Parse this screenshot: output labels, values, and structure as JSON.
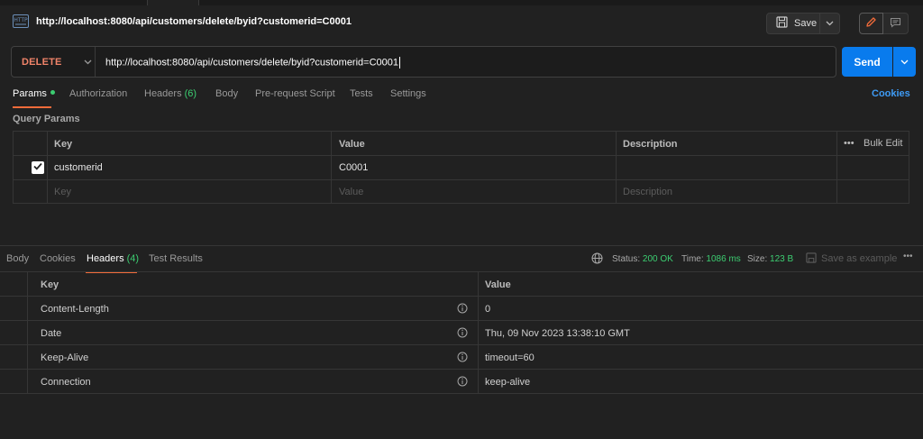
{
  "request": {
    "title": "http://localhost:8080/api/customers/delete/byid?customerid=C0001",
    "method": "DELETE",
    "url": "http://localhost:8080/api/customers/delete/byid?customerid=C0001",
    "save_label": "Save",
    "send_label": "Send"
  },
  "request_tabs": {
    "params": "Params",
    "authorization": "Authorization",
    "headers": "Headers",
    "headers_count": "(6)",
    "body": "Body",
    "prerequest": "Pre-request Script",
    "tests": "Tests",
    "settings": "Settings",
    "cookies": "Cookies"
  },
  "query_params": {
    "label": "Query Params",
    "columns": {
      "key": "Key",
      "value": "Value",
      "description": "Description",
      "bulk_edit": "Bulk Edit"
    },
    "rows": [
      {
        "key": "customerid",
        "value": "C0001",
        "description": "",
        "checked": true
      }
    ],
    "placeholder": {
      "key": "Key",
      "value": "Value",
      "description": "Description"
    }
  },
  "response_tabs": {
    "body": "Body",
    "cookies": "Cookies",
    "headers": "Headers",
    "headers_count": "(4)",
    "test_results": "Test Results"
  },
  "response_status": {
    "status_label": "Status:",
    "status_value": "200 OK",
    "time_label": "Time:",
    "time_value": "1086 ms",
    "size_label": "Size:",
    "size_value": "123 B",
    "save_example": "Save as example"
  },
  "response_headers": {
    "columns": {
      "key": "Key",
      "value": "Value"
    },
    "rows": [
      {
        "key": "Content-Length",
        "value": "0"
      },
      {
        "key": "Date",
        "value": "Thu, 09 Nov 2023 13:38:10 GMT"
      },
      {
        "key": "Keep-Alive",
        "value": "timeout=60"
      },
      {
        "key": "Connection",
        "value": "keep-alive"
      }
    ]
  },
  "colors": {
    "accent_orange": "#f26b3a",
    "method_delete": "#f08369",
    "send_blue": "#097bed",
    "success_green": "#3ccd71",
    "link_blue": "#3e9bf5"
  }
}
